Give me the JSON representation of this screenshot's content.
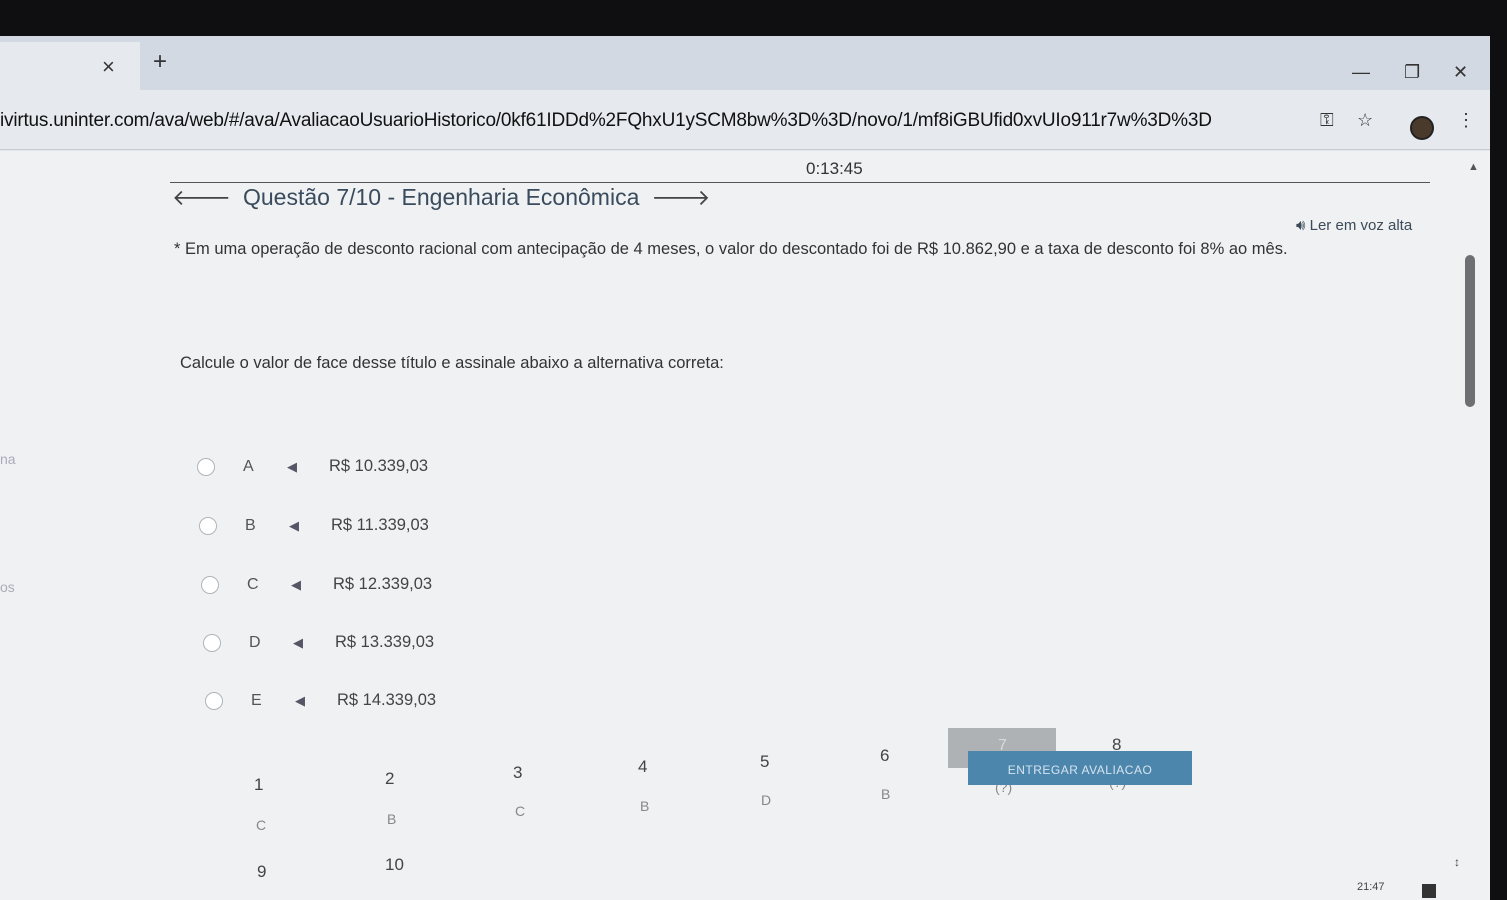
{
  "browser": {
    "tab": {
      "close_icon": "×",
      "new_tab_icon": "+"
    },
    "window_controls": {
      "minimize": "—",
      "restore": "❐",
      "close": "✕"
    },
    "url": "ivirtus.uninter.com/ava/web/#/ava/AvaliacaoUsuarioHistorico/0kf61IDDd%2FQhxU1ySCM8bw%3D%3D/novo/1/mf8iGBUfid0xvUIo911r7w%3D%3D",
    "icons": {
      "key": "⚿",
      "star": "☆",
      "menu": "⋮"
    }
  },
  "page": {
    "timer": "0:13:45",
    "question_title": "Questão 7/10 - Engenharia Econômica",
    "read_aloud": "Ler em voz alta",
    "question_text": "* Em uma operação de desconto racional com antecipação de 4 meses, o valor do descontado foi de R$ 10.862,90 e a taxa de desconto foi 8% ao mês.",
    "instruction": "Calcule o valor de face desse título e assinale abaixo a alternativa correta:",
    "side_fragments": [
      "na",
      "os"
    ],
    "options": [
      {
        "letter": "A",
        "value": "R$ 10.339,03"
      },
      {
        "letter": "B",
        "value": "R$ 11.339,03"
      },
      {
        "letter": "C",
        "value": "R$ 12.339,03"
      },
      {
        "letter": "D",
        "value": "R$ 13.339,03"
      },
      {
        "letter": "E",
        "value": "R$ 14.339,03"
      }
    ],
    "nav": [
      {
        "num": "1",
        "ans": "C"
      },
      {
        "num": "2",
        "ans": "B"
      },
      {
        "num": "3",
        "ans": "C"
      },
      {
        "num": "4",
        "ans": "B"
      },
      {
        "num": "5",
        "ans": "D"
      },
      {
        "num": "6",
        "ans": "B"
      },
      {
        "num": "7",
        "ans": "(?)"
      },
      {
        "num": "8",
        "ans": "(?)"
      },
      {
        "num": "9",
        "ans": "(?)"
      },
      {
        "num": "10",
        "ans": "(?)"
      }
    ],
    "submit_label": "ENTREGAR AVALIACAO"
  },
  "taskbar": {
    "clock": "21:47"
  }
}
